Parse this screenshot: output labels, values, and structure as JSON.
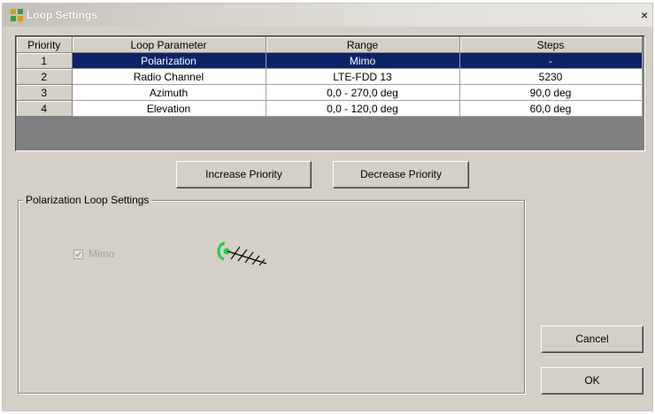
{
  "window": {
    "title": "Loop Settings",
    "close_glyph": "×"
  },
  "table": {
    "columns": [
      "Priority",
      "Loop Parameter",
      "Range",
      "Steps"
    ],
    "rows": [
      {
        "priority": "1",
        "parameter": "Polarization",
        "range": "Mimo",
        "steps": "-",
        "selected": true
      },
      {
        "priority": "2",
        "parameter": "Radio Channel",
        "range": "LTE-FDD 13",
        "steps": "5230"
      },
      {
        "priority": "3",
        "parameter": "Azimuth",
        "range": "0,0 - 270,0 deg",
        "steps": "90,0 deg"
      },
      {
        "priority": "4",
        "parameter": "Elevation",
        "range": "0,0 - 120,0 deg",
        "steps": "60,0 deg"
      }
    ]
  },
  "buttons": {
    "increase": "Increase Priority",
    "decrease": "Decrease Priority",
    "cancel": "Cancel",
    "ok": "OK"
  },
  "polarization_group": {
    "legend": "Polarization Loop Settings",
    "mimo_label": "Mimo",
    "mimo_checked": true,
    "mimo_enabled": false,
    "icon": "polarization-antenna-icon"
  },
  "colors": {
    "selection": "#0a246a",
    "dialog_bg": "#d4d0c8",
    "grid_empty": "#808080",
    "antenna_accent": "#22cc44"
  }
}
